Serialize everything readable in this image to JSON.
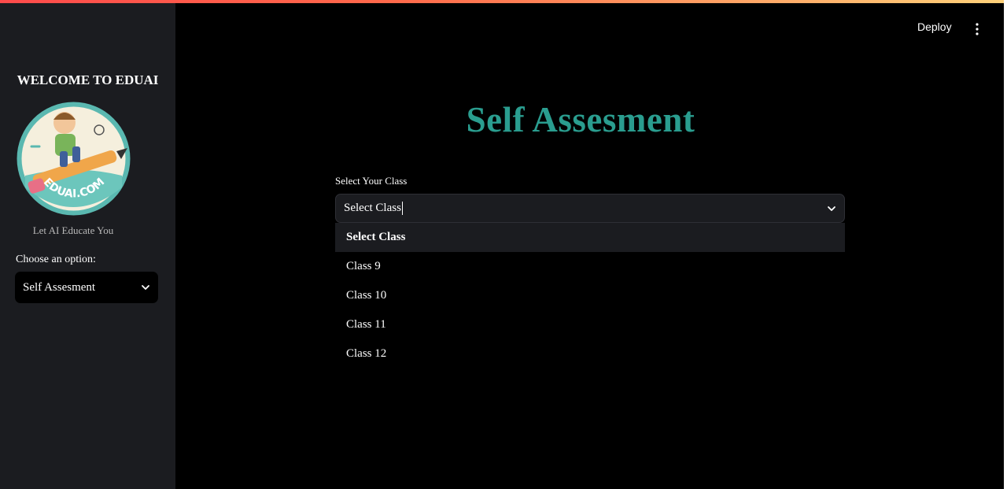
{
  "sidebar": {
    "title": "WELCOME TO EDUAI",
    "logo_text": "EDUAI.COM",
    "tagline": "Let AI Educate You",
    "choose_label": "Choose an option:",
    "option_value": "Self Assesment"
  },
  "header": {
    "deploy_label": "Deploy",
    "menu_icon": "kebab-menu-icon"
  },
  "main": {
    "title": "Self Assesment",
    "class_select": {
      "label": "Select Your Class",
      "value": "Select Class",
      "options": [
        "Select Class",
        "Class 9",
        "Class 10",
        "Class 11",
        "Class 12"
      ]
    }
  },
  "colors": {
    "accent": "#2a9d8f",
    "sidebar_bg": "#1b1c20",
    "main_bg": "#000000"
  }
}
